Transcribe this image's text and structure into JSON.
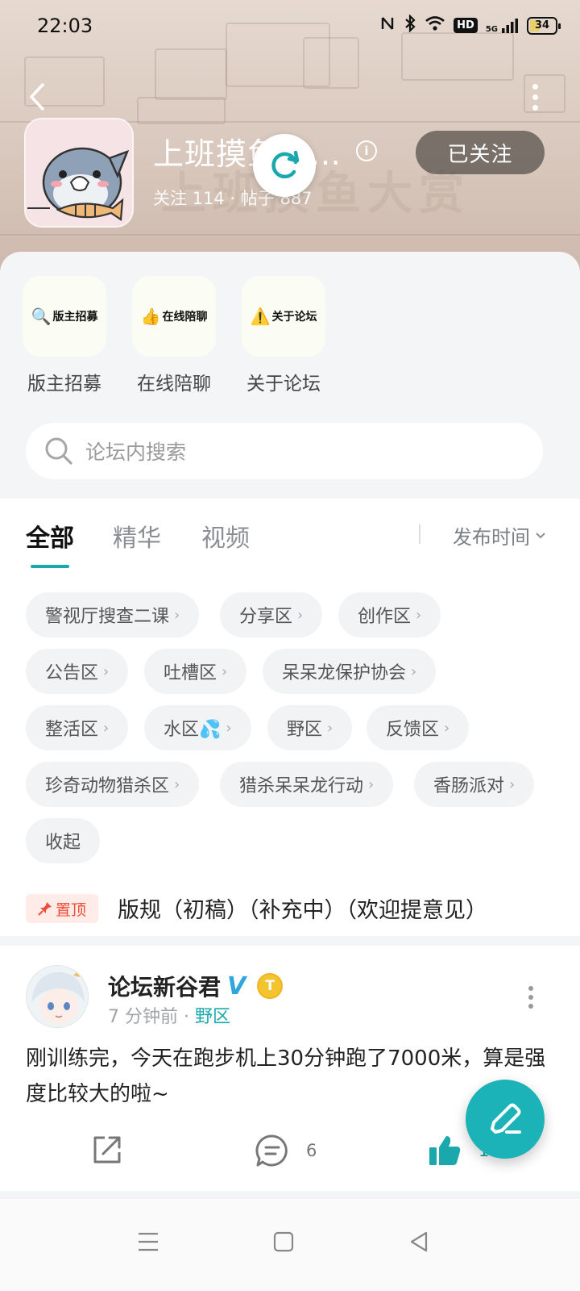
{
  "status_bar": {
    "time": "22:03",
    "network": "5G",
    "hd_label": "HD",
    "battery": "34"
  },
  "header": {
    "forum_title": "上班摸鱼大赏...",
    "follow_label": "已关注",
    "stats": "关注 114 · 帖子 887",
    "ghost_text": "上班摸鱼大赏",
    "icons": [
      "back-icon",
      "more-icon",
      "info-icon",
      "refresh-icon"
    ]
  },
  "shortcuts": [
    {
      "tile_text": "版主招募",
      "emoji": "🔍",
      "label": "版主招募"
    },
    {
      "tile_text": "在线陪聊",
      "emoji": "👍",
      "label": "在线陪聊"
    },
    {
      "tile_text": "关于论坛",
      "emoji": "⚠️",
      "label": "关于论坛"
    }
  ],
  "search": {
    "placeholder": "论坛内搜索"
  },
  "tabs": {
    "items": [
      "全部",
      "精华",
      "视频"
    ],
    "active_index": 0,
    "sort_label": "发布时间"
  },
  "categories": {
    "items": [
      "警视厅搜查二课",
      "分享区",
      "创作区",
      "公告区",
      "吐槽区",
      "呆呆龙保护协会",
      "整活区",
      "水区💦",
      "野区",
      "反馈区",
      "珍奇动物猎杀区",
      "猎杀呆呆龙行动",
      "香肠派对"
    ],
    "collapse_label": "收起"
  },
  "pinned": {
    "badge": "置顶",
    "title": "版规（初稿）（补充中）（欢迎提意见）"
  },
  "post": {
    "author": "论坛新谷君",
    "verified": "V",
    "level_badge": "T",
    "time": "7 分钟前",
    "dot": "·",
    "zone": "野区",
    "body": "刚训练完，今天在跑步机上30分钟跑了7000米，算是强度比较大的啦~",
    "comment_count": "6",
    "like_count": "1"
  },
  "colors": {
    "accent": "#1aa8ad",
    "pin_red": "#ef4b37",
    "header_bg": "#d9c8bd",
    "follow_bg": "#554e4a"
  }
}
